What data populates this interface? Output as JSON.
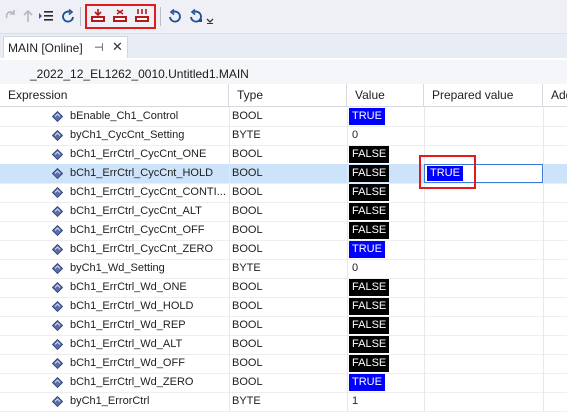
{
  "toolbar": {
    "buttons": [
      {
        "icon": "redo-icon",
        "enabled": false
      },
      {
        "icon": "arrow-up-icon",
        "enabled": false
      },
      {
        "icon": "list-indent-icon",
        "enabled": true
      },
      {
        "icon": "refresh-icon",
        "enabled": true
      },
      {
        "icon": "login-icon",
        "enabled": true
      },
      {
        "icon": "logout-icon",
        "enabled": true
      },
      {
        "icon": "download-icon",
        "enabled": true
      },
      {
        "icon": "reset-icon",
        "enabled": true
      },
      {
        "icon": "reset-cold-icon",
        "enabled": true
      },
      {
        "icon": "overflow-chevron-icon",
        "enabled": true
      }
    ]
  },
  "tab": {
    "title": "MAIN [Online]",
    "pin": "⊣",
    "close": "✕"
  },
  "path": {
    "title": "_2022_12_EL1262_0010.Untitled1.MAIN"
  },
  "columns": {
    "expression": "Expression",
    "type": "Type",
    "value": "Value",
    "prepared_value": "Prepared value",
    "address": "Add"
  },
  "rows": [
    {
      "expression": "bEnable_Ch1_Control",
      "type": "BOOL",
      "value": "TRUE",
      "value_style": "true"
    },
    {
      "expression": "byCh1_CycCnt_Setting",
      "type": "BYTE",
      "value": "0",
      "value_style": "plain"
    },
    {
      "expression": "bCh1_ErrCtrl_CycCnt_ONE",
      "type": "BOOL",
      "value": "FALSE",
      "value_style": "false"
    },
    {
      "expression": "bCh1_ErrCtrl_CycCnt_HOLD",
      "type": "BOOL",
      "value": "FALSE",
      "value_style": "false",
      "selected": true,
      "prepared": "TRUE"
    },
    {
      "expression": "bCh1_ErrCtrl_CycCnt_CONTI...",
      "type": "BOOL",
      "value": "FALSE",
      "value_style": "false"
    },
    {
      "expression": "bCh1_ErrCtrl_CycCnt_ALT",
      "type": "BOOL",
      "value": "FALSE",
      "value_style": "false"
    },
    {
      "expression": "bCh1_ErrCtrl_CycCnt_OFF",
      "type": "BOOL",
      "value": "FALSE",
      "value_style": "false"
    },
    {
      "expression": "bCh1_ErrCtrl_CycCnt_ZERO",
      "type": "BOOL",
      "value": "TRUE",
      "value_style": "true"
    },
    {
      "expression": "byCh1_Wd_Setting",
      "type": "BYTE",
      "value": "0",
      "value_style": "plain"
    },
    {
      "expression": "bCh1_ErrCtrl_Wd_ONE",
      "type": "BOOL",
      "value": "FALSE",
      "value_style": "false"
    },
    {
      "expression": "bCh1_ErrCtrl_Wd_HOLD",
      "type": "BOOL",
      "value": "FALSE",
      "value_style": "false"
    },
    {
      "expression": "bCh1_ErrCtrl_Wd_REP",
      "type": "BOOL",
      "value": "FALSE",
      "value_style": "false"
    },
    {
      "expression": "bCh1_ErrCtrl_Wd_ALT",
      "type": "BOOL",
      "value": "FALSE",
      "value_style": "false"
    },
    {
      "expression": "bCh1_ErrCtrl_Wd_OFF",
      "type": "BOOL",
      "value": "FALSE",
      "value_style": "false"
    },
    {
      "expression": "bCh1_ErrCtrl_Wd_ZERO",
      "type": "BOOL",
      "value": "TRUE",
      "value_style": "true"
    },
    {
      "expression": "byCh1_ErrorCtrl",
      "type": "BYTE",
      "value": "1",
      "value_style": "plain"
    }
  ],
  "colors": {
    "true_bg": "#0000ff",
    "false_bg": "#000000",
    "selection": "#cde3fa",
    "highlight": "#e21a1a"
  }
}
